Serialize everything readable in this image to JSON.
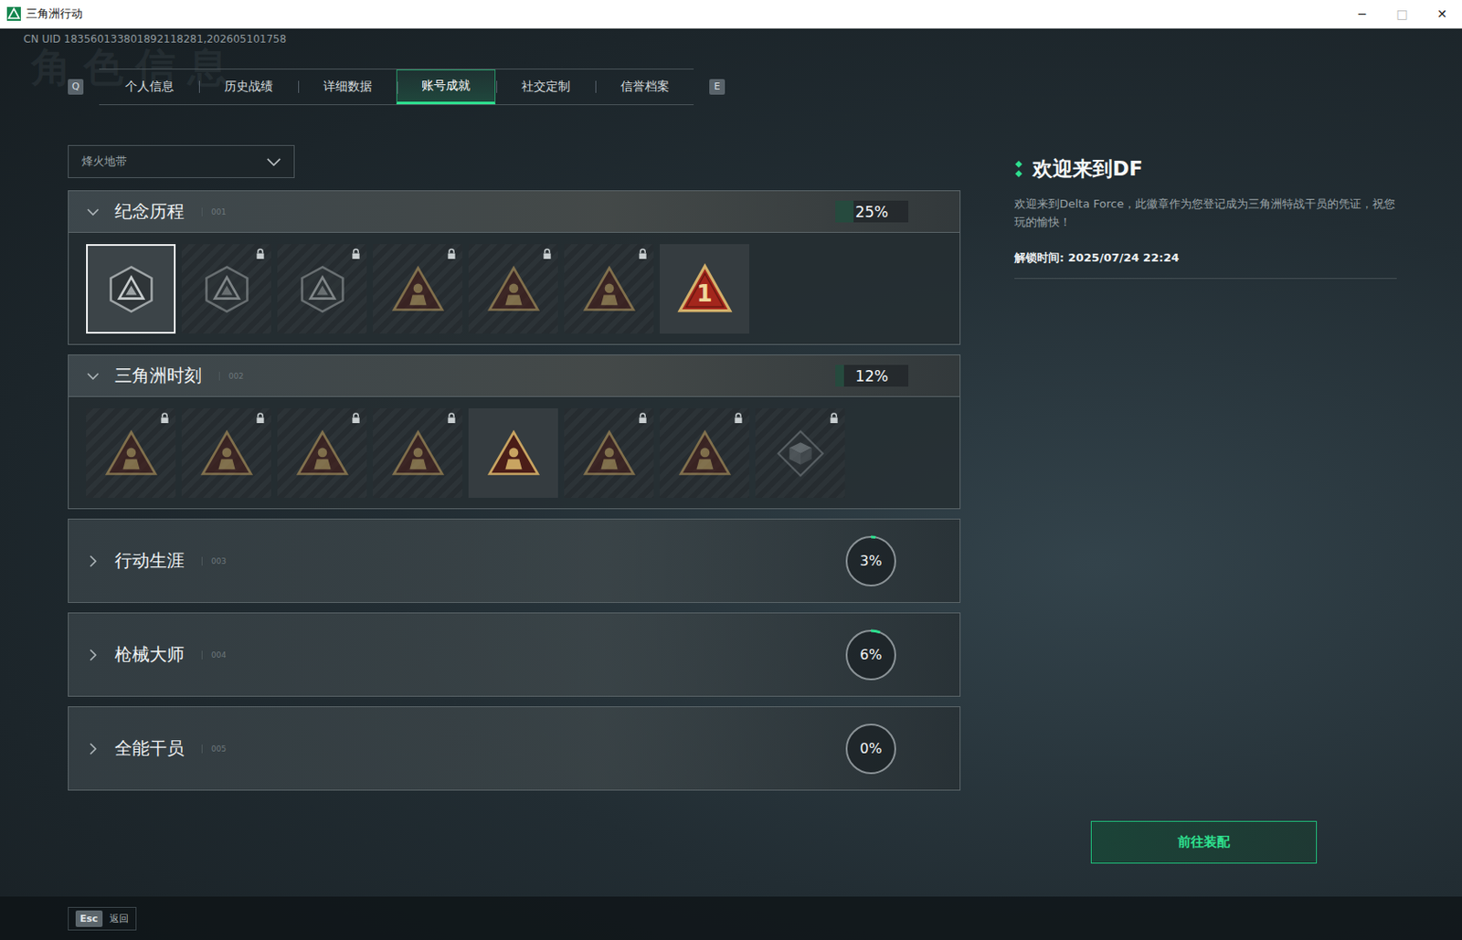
{
  "window": {
    "title": "三角洲行动",
    "controls": [
      {
        "glyph": "─",
        "disabled": false
      },
      {
        "glyph": "□",
        "disabled": true
      },
      {
        "glyph": "✕",
        "disabled": false
      }
    ]
  },
  "uid": "CN UID 183560133801892118281,202605101758",
  "watermark": "角色信息",
  "tabs": {
    "prev_key": "Q",
    "next_key": "E",
    "items": [
      {
        "label": "个人信息",
        "selected": false
      },
      {
        "label": "历史战绩",
        "selected": false
      },
      {
        "label": "详细数据",
        "selected": false
      },
      {
        "label": "账号成就",
        "selected": true
      },
      {
        "label": "社交定制",
        "selected": false
      },
      {
        "label": "信誉档案",
        "selected": false
      }
    ]
  },
  "mode_select": {
    "value": "烽火地带"
  },
  "sections": [
    {
      "title": "纪念历程",
      "index": "001",
      "progress": "25%",
      "level": 0.25,
      "expanded": true,
      "badges": [
        {
          "kind": "shield",
          "locked": false,
          "selected": true,
          "label": ""
        },
        {
          "kind": "shield",
          "locked": true,
          "selected": false,
          "label": ""
        },
        {
          "kind": "shield",
          "locked": true,
          "selected": false,
          "label": ""
        },
        {
          "kind": "triangle",
          "locked": true,
          "selected": false,
          "label": ""
        },
        {
          "kind": "triangle",
          "locked": true,
          "selected": false,
          "label": ""
        },
        {
          "kind": "triangle",
          "locked": true,
          "selected": false,
          "label": ""
        },
        {
          "kind": "rank",
          "locked": false,
          "selected": false,
          "label": "1"
        }
      ]
    },
    {
      "title": "三角洲时刻",
      "index": "002",
      "progress": "12%",
      "level": 0.12,
      "expanded": true,
      "badges": [
        {
          "kind": "triangle",
          "locked": true,
          "selected": false,
          "label": ""
        },
        {
          "kind": "triangle",
          "locked": true,
          "selected": false,
          "label": ""
        },
        {
          "kind": "triangle",
          "locked": true,
          "selected": false,
          "label": ""
        },
        {
          "kind": "triangle",
          "locked": true,
          "selected": false,
          "label": ""
        },
        {
          "kind": "triangle",
          "locked": false,
          "selected": false,
          "label": ""
        },
        {
          "kind": "triangle",
          "locked": true,
          "selected": false,
          "label": ""
        },
        {
          "kind": "triangle",
          "locked": true,
          "selected": false,
          "label": ""
        },
        {
          "kind": "cube",
          "locked": true,
          "selected": false,
          "label": ""
        }
      ]
    },
    {
      "title": "行动生涯",
      "index": "003",
      "progress": "3%",
      "level": 0.03,
      "expanded": false,
      "badges": []
    },
    {
      "title": "枪械大师",
      "index": "004",
      "progress": "6%",
      "level": 0.06,
      "expanded": false,
      "badges": []
    },
    {
      "title": "全能干员",
      "index": "005",
      "progress": "0%",
      "level": 0,
      "expanded": false,
      "badges": []
    }
  ],
  "detail": {
    "title": "欢迎来到DF",
    "description": "欢迎来到Delta Force，此徽章作为您登记成为三角洲特战干员的凭证，祝您玩的愉快！",
    "unlock_time": "解锁时间: 2025/07/24 22:24"
  },
  "equip_button": "前往装配",
  "footer": {
    "key": "Esc",
    "label": "返回"
  }
}
